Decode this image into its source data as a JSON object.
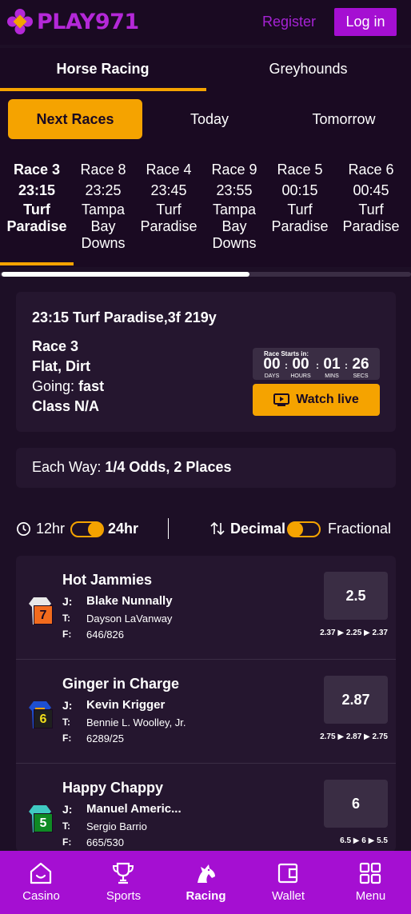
{
  "header": {
    "logo_text": "PLAY971",
    "register_label": "Register",
    "login_label": "Log in"
  },
  "sport_tabs": [
    {
      "label": "Horse Racing",
      "active": true
    },
    {
      "label": "Greyhounds",
      "active": false
    }
  ],
  "day_tabs": [
    {
      "label": "Next Races",
      "active": true
    },
    {
      "label": "Today",
      "active": false
    },
    {
      "label": "Tomorrow",
      "active": false
    }
  ],
  "races": [
    {
      "race": "Race 3",
      "time": "23:15",
      "track_lines": [
        "Turf",
        "Paradise"
      ],
      "active": true
    },
    {
      "race": "Race 8",
      "time": "23:25",
      "track_lines": [
        "Tampa",
        "Bay",
        "Downs"
      ],
      "active": false
    },
    {
      "race": "Race 4",
      "time": "23:45",
      "track_lines": [
        "Turf",
        "Paradise"
      ],
      "active": false
    },
    {
      "race": "Race 9",
      "time": "23:55",
      "track_lines": [
        "Tampa",
        "Bay",
        "Downs"
      ],
      "active": false
    },
    {
      "race": "Race 5",
      "time": "00:15",
      "track_lines": [
        "Turf",
        "Paradise"
      ],
      "active": false
    },
    {
      "race": "Race 6",
      "time": "00:45",
      "track_lines": [
        "Turf",
        "Paradise"
      ],
      "active": false
    }
  ],
  "race_info": {
    "heading": "23:15 Turf Paradise,3f 219y",
    "race_number": "Race 3",
    "surface": "Flat, Dirt",
    "going_label": "Going:",
    "going_value": "fast",
    "class_text": "Class N/A",
    "countdown": {
      "label": "Race Starts in:",
      "days": "00",
      "days_cap": "DAYS",
      "hours": "00",
      "hours_cap": "HOURS",
      "mins": "01",
      "mins_cap": "MINS",
      "secs": "26",
      "secs_cap": "SECS"
    },
    "watch_label": "Watch live"
  },
  "each_way": {
    "label": "Each Way:",
    "value": "1/4 Odds, 2 Places"
  },
  "toggles": {
    "hr12": "12hr",
    "hr24": "24hr",
    "decimal": "Decimal",
    "fractional": "Fractional"
  },
  "runners": [
    {
      "name": "Hot Jammies",
      "number": "7",
      "saddle_color": "#f26b1d",
      "number_color": "#1a0a22",
      "silk_color": "#e8e8e8",
      "silk_accent": "#5aa9e6",
      "jockey_label": "J:",
      "jockey": "Blake Nunnally",
      "trainer_label": "T:",
      "trainer": "Dayson LaVanway",
      "form_label": "F:",
      "form": "646/826",
      "odds": "2.5",
      "history": [
        "2.37",
        "2.25",
        "2.37"
      ]
    },
    {
      "name": "Ginger in Charge",
      "number": "6",
      "saddle_color": "#1f1f1f",
      "number_color": "#f2e01b",
      "silk_color": "#1e4fd1",
      "silk_accent": "#f5a300",
      "jockey_label": "J:",
      "jockey": "Kevin Krigger",
      "trainer_label": "T:",
      "trainer": "Bennie L. Woolley, Jr.",
      "form_label": "F:",
      "form": "6289/25",
      "odds": "2.87",
      "history": [
        "2.75",
        "2.87",
        "2.75"
      ]
    },
    {
      "name": "Happy Chappy",
      "number": "5",
      "saddle_color": "#0f8a24",
      "number_color": "#ffffff",
      "silk_color": "#3fc9c2",
      "silk_accent": "#e8e8e8",
      "jockey_label": "J:",
      "jockey": "Manuel Americ...",
      "trainer_label": "T:",
      "trainer": "Sergio Barrio",
      "form_label": "F:",
      "form": "665/530",
      "odds": "6",
      "history": [
        "6.5",
        "6",
        "5.5"
      ]
    }
  ],
  "bottom_nav": [
    {
      "label": "Casino",
      "icon": "casino-icon",
      "active": false
    },
    {
      "label": "Sports",
      "icon": "trophy-icon",
      "active": false
    },
    {
      "label": "Racing",
      "icon": "horse-icon",
      "active": true
    },
    {
      "label": "Wallet",
      "icon": "wallet-icon",
      "active": false
    },
    {
      "label": "Menu",
      "icon": "grid-icon",
      "active": false
    }
  ],
  "colors": {
    "background": "#1d0f26",
    "accent_orange": "#f5a300",
    "brand_purple": "#a50fd2",
    "card": "#25162f"
  }
}
